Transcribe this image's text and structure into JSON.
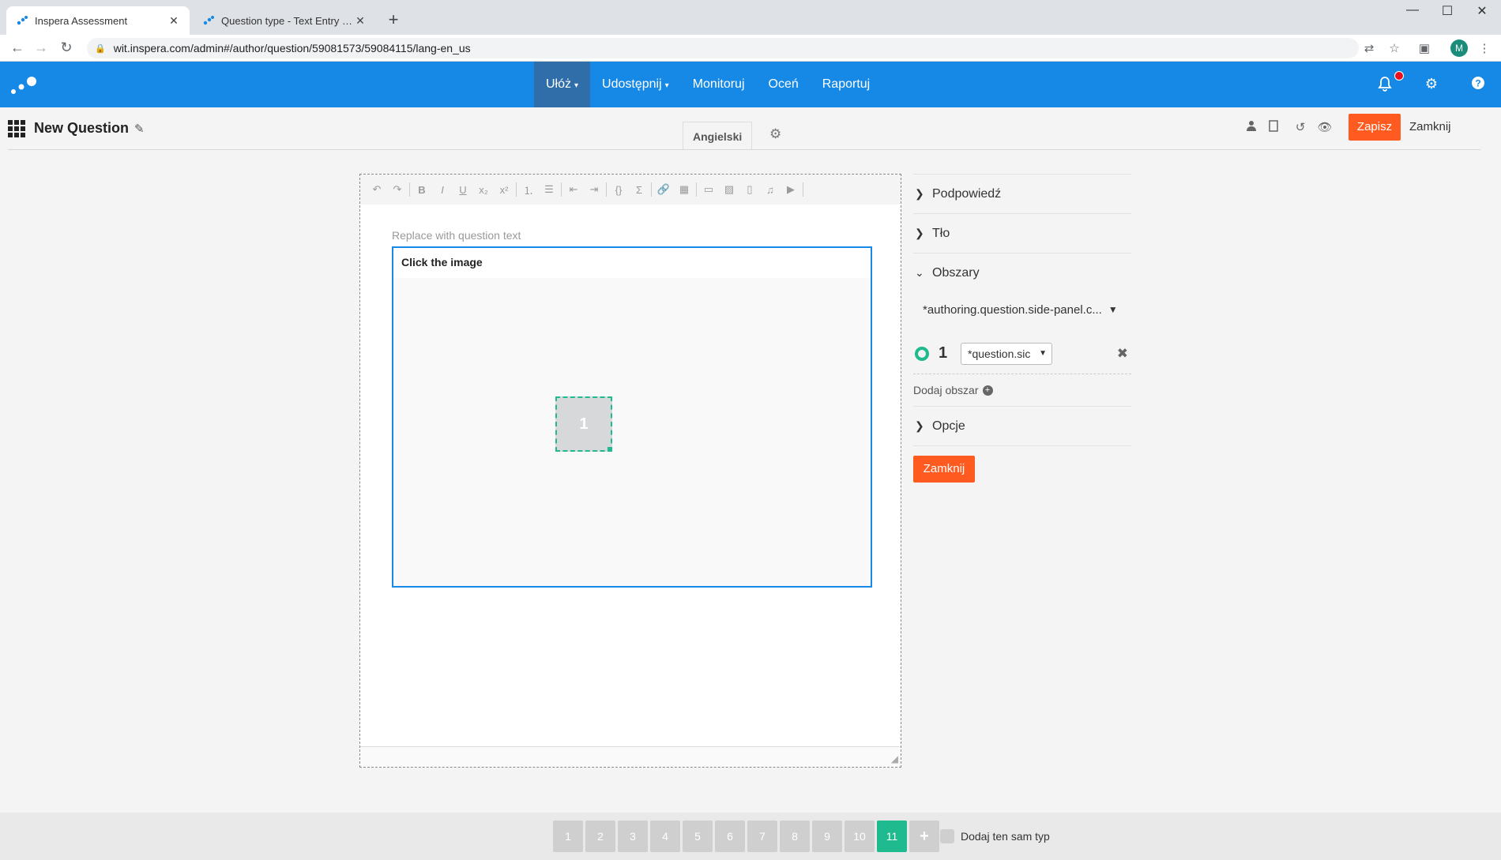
{
  "browser": {
    "tabs": [
      {
        "title": "Inspera Assessment"
      },
      {
        "title": "Question type - Text Entry – Insp"
      }
    ],
    "url": "wit.inspera.com/admin#/author/question/59081573/59084115/lang-en_us",
    "profile_initial": "M",
    "window_controls": {
      "minimize": "—",
      "maximize": "☐",
      "close": "✕"
    }
  },
  "app_bar": {
    "nav": [
      {
        "label": "Ułóż",
        "has_dropdown": true,
        "active": true
      },
      {
        "label": "Udostępnij",
        "has_dropdown": true,
        "active": false
      },
      {
        "label": "Monitoruj",
        "has_dropdown": false,
        "active": false
      },
      {
        "label": "Oceń",
        "has_dropdown": false,
        "active": false
      },
      {
        "label": "Raportuj",
        "has_dropdown": false,
        "active": false
      }
    ],
    "icons": [
      "bell-icon",
      "gear-icon",
      "help-icon"
    ],
    "colors": {
      "bar": "#1589e5",
      "active": "#2f6ea8",
      "notification": "#e8101f"
    }
  },
  "toolbar": {
    "title": "New Question",
    "language_tab": "Angielski",
    "save_label": "Zapisz",
    "close_label": "Zamknij",
    "icons": [
      "user-icon",
      "bookmark-icon",
      "history-icon",
      "preview-icon"
    ]
  },
  "editor": {
    "placeholder": "Replace with question text",
    "question_text": "Click the image",
    "hotspot_label": "1",
    "toolbar_icons": [
      "undo-icon",
      "redo-icon",
      "bold-icon",
      "italic-icon",
      "underline-icon",
      "subscript-icon",
      "superscript-icon",
      "ordered-list-icon",
      "unordered-list-icon",
      "outdent-icon",
      "indent-icon",
      "code-icon",
      "sigma-icon",
      "link-icon",
      "table-icon",
      "unlink-icon",
      "image-icon",
      "document-icon",
      "audio-icon",
      "video-icon"
    ]
  },
  "side_panel": {
    "sections": {
      "hint": "Podpowiedź",
      "background": "Tło",
      "areas": "Obszary",
      "options": "Opcje"
    },
    "area_selector": "*authoring.question.side-panel.c...",
    "region": {
      "number": "1",
      "dropdown_value": "*question.sic"
    },
    "add_area": "Dodaj obszar",
    "close_label": "Zamknij",
    "accent": "#ff5a1f",
    "region_color": "#1fbb8e"
  },
  "pager": {
    "pages": [
      "1",
      "2",
      "3",
      "4",
      "5",
      "6",
      "7",
      "8",
      "9",
      "10",
      "11"
    ],
    "active": "11",
    "add_label": "+",
    "same_type_label": "Dodaj ten sam typ"
  }
}
